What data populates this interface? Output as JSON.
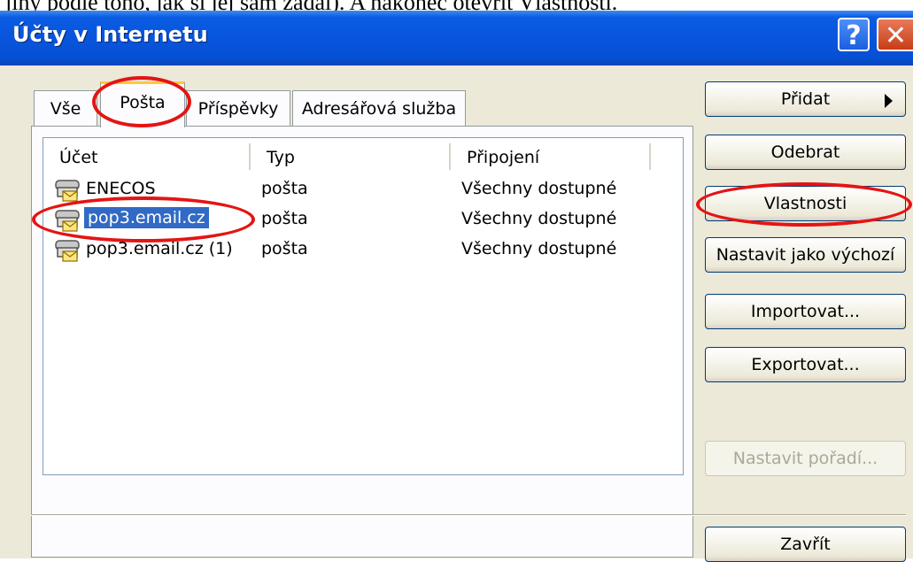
{
  "doc_fragment": "jiný podle toho, jak si jej sám zadal). A nakonec otevřít Vlastnosti.",
  "window": {
    "title": "Účty v Internetu",
    "help_glyph": "?",
    "close_glyph": "✕"
  },
  "tabs": [
    {
      "label": "Vše",
      "active": false
    },
    {
      "label": "Pošta",
      "active": true
    },
    {
      "label": "Příspěvky",
      "active": false
    },
    {
      "label": "Adresářová služba",
      "active": false
    }
  ],
  "list": {
    "columns": [
      "Účet",
      "Typ",
      "Připojení"
    ],
    "rows": [
      {
        "account": "ENECOS",
        "type": "pošta",
        "connection": "Všechny dostupné",
        "selected": false,
        "icon": "mail-account-icon"
      },
      {
        "account": "pop3.email.cz",
        "type": "pošta",
        "connection": "Všechny dostupné",
        "selected": true,
        "icon": "mail-account-icon"
      },
      {
        "account": "pop3.email.cz (1)",
        "type": "pošta",
        "connection": "Všechny dostupné",
        "selected": false,
        "icon": "mail-account-icon"
      }
    ]
  },
  "buttons": {
    "add": "Přidat",
    "remove": "Odebrat",
    "properties": "Vlastnosti",
    "set_default": "Nastavit jako výchozí",
    "import": "Importovat...",
    "export": "Exportovat...",
    "set_order": "Nastavit pořadí...",
    "close": "Zavřít"
  },
  "colors": {
    "titlebar": "#0855dd",
    "selection": "#316ac5",
    "annotation": "#e41414",
    "tab_highlight": "#ffc83c"
  }
}
